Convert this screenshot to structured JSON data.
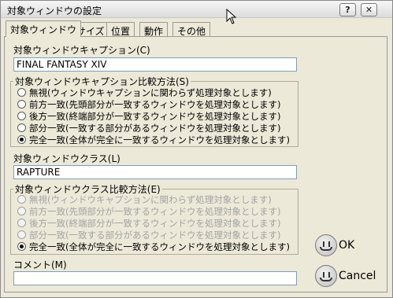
{
  "window": {
    "title": "対象ウィンドウの設定"
  },
  "titlebar": {
    "help_label": "?",
    "close_label": "✕"
  },
  "tabs": [
    {
      "label": "対象ウィンドウ",
      "active": true
    },
    {
      "label": "サイズ"
    },
    {
      "label": "位置"
    },
    {
      "label": "動作"
    },
    {
      "label": "その他"
    }
  ],
  "caption": {
    "label": "対象ウィンドウキャプション(C)",
    "value": "FINAL FANTASY XIV"
  },
  "caption_compare": {
    "legend": "対象ウィンドウキャプション比較方法(S)",
    "options": [
      {
        "label": "無視(ウィンドウキャプションに関わらず処理対象とします)",
        "checked": false
      },
      {
        "label": "前方一致(先頭部分が一致するウィンドウを処理対象とします)",
        "checked": false
      },
      {
        "label": "後方一致(終端部分が一致するウィンドウを処理対象とします)",
        "checked": false
      },
      {
        "label": "部分一致(一致する部分があるウィンドウを処理対象とします)",
        "checked": false
      },
      {
        "label": "完全一致(全体が完全に一致するウィンドウを処理対象とします)",
        "checked": true
      }
    ]
  },
  "class": {
    "label": "対象ウィンドウクラス(L)",
    "value": "RAPTURE"
  },
  "class_compare": {
    "legend": "対象ウィンドウクラス比較方法(E)",
    "options": [
      {
        "label": "無視(ウィンドウキャプションに関わらず処理対象とします)",
        "checked": false,
        "disabled": true
      },
      {
        "label": "前方一致(先頭部分が一致するウィンドウを処理対象とします)",
        "checked": false,
        "disabled": true
      },
      {
        "label": "後方一致(終端部分が一致するウィンドウを処理対象とします)",
        "checked": false,
        "disabled": true
      },
      {
        "label": "部分一致(一致する部分があるウィンドウを処理対象とします)",
        "checked": false,
        "disabled": true
      },
      {
        "label": "完全一致(全体が完全に一致するウィンドウを処理対象とします)",
        "checked": true,
        "disabled": false
      }
    ]
  },
  "comment": {
    "label": "コメント(M)",
    "value": ""
  },
  "buttons": {
    "ok": "OK",
    "cancel": "Cancel"
  }
}
